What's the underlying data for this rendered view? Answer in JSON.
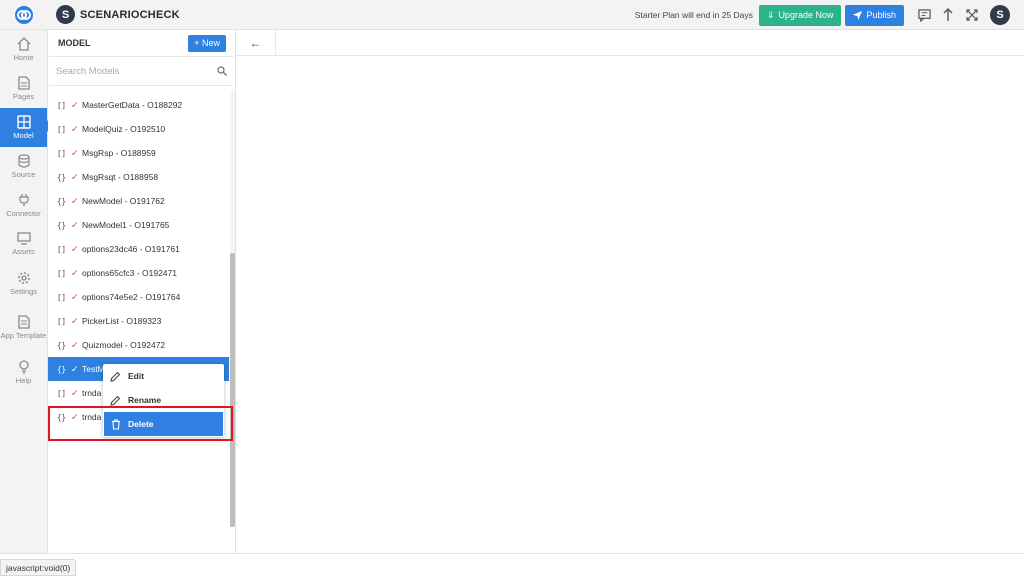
{
  "header": {
    "brand_initial": "S",
    "brand_name": "SCENARIOCHECK",
    "plan_notice": "Starter Plan will end in 25 Days",
    "upgrade_label": "Upgrade Now",
    "publish_label": "Publish",
    "avatar_initial": "S"
  },
  "rail": {
    "items": [
      {
        "label": "Home",
        "icon": "home-icon"
      },
      {
        "label": "Pages",
        "icon": "pages-icon"
      },
      {
        "label": "Model",
        "icon": "table-icon"
      },
      {
        "label": "Source",
        "icon": "database-icon"
      },
      {
        "label": "Connector",
        "icon": "plug-icon"
      },
      {
        "label": "Assets",
        "icon": "monitor-icon"
      },
      {
        "label": "Settings",
        "icon": "gear-icon"
      },
      {
        "label": "App Template",
        "icon": "document-icon"
      },
      {
        "label": "Help",
        "icon": "lightbulb-icon"
      }
    ],
    "active": "Model"
  },
  "panel": {
    "title": "MODEL",
    "new_label": "+ New",
    "search_placeholder": "Search Models",
    "models": [
      {
        "bracket": "[]",
        "name": "MasterGetData - O188292"
      },
      {
        "bracket": "[]",
        "name": "ModelQuiz - O192510"
      },
      {
        "bracket": "[]",
        "name": "MsgRsp - O188959"
      },
      {
        "bracket": "{}",
        "name": "MsgRsqt - O188958"
      },
      {
        "bracket": "{}",
        "name": "NewModel - O191762"
      },
      {
        "bracket": "{}",
        "name": "NewModel1 - O191765"
      },
      {
        "bracket": "[]",
        "name": "options23dc46 - O191761"
      },
      {
        "bracket": "[]",
        "name": "options65cfc3 - O192471"
      },
      {
        "bracket": "[]",
        "name": "options74e5e2 - O191764"
      },
      {
        "bracket": "[]",
        "name": "PickerList - O189323"
      },
      {
        "bracket": "{}",
        "name": "Quizmodel - O192472"
      },
      {
        "bracket": "{}",
        "name": "TestM"
      },
      {
        "bracket": "[]",
        "name": "trnda"
      },
      {
        "bracket": "{}",
        "name": "trnda"
      }
    ],
    "selected_index": 11
  },
  "context_menu": {
    "items": [
      {
        "label": "Edit",
        "icon": "pencil-icon"
      },
      {
        "label": "Rename",
        "icon": "pencil-icon"
      },
      {
        "label": "Delete",
        "icon": "trash-icon"
      }
    ],
    "highlighted": "Delete"
  },
  "content": {
    "back_symbol": "←"
  },
  "status_bar": {
    "text": "javascript:void(0)"
  },
  "colors": {
    "primary": "#2f80e0",
    "upgrade": "#2eb28b",
    "check": "#e0454a",
    "highlight_box": "#e0161e"
  }
}
